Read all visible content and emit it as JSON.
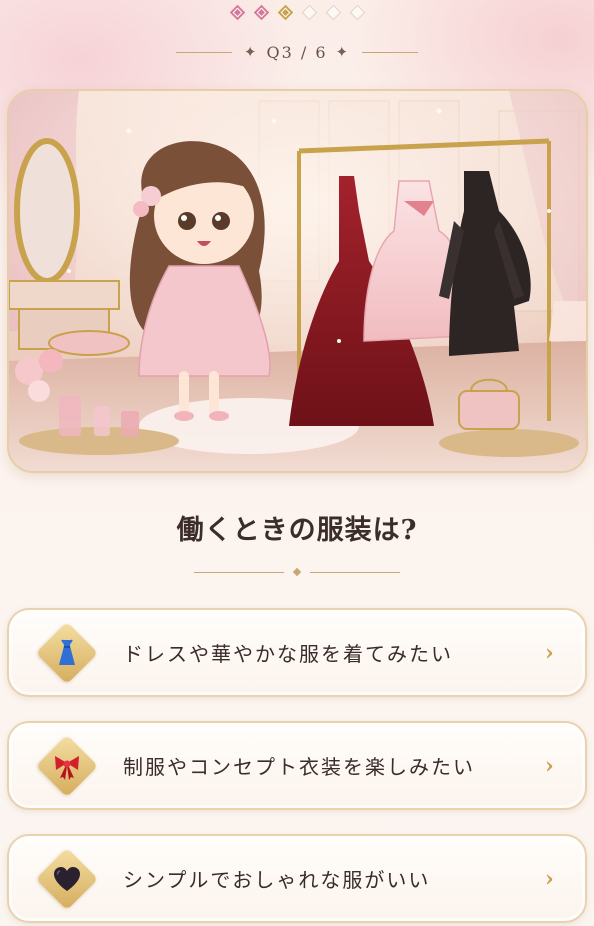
{
  "progress": {
    "counter": "Q3 / 6",
    "steps": [
      "done",
      "done",
      "current",
      "todo",
      "todo",
      "todo"
    ]
  },
  "question": "働くときの服装は?",
  "options": [
    {
      "label": "ドレスや華やかな服を着てみたい",
      "icon": "blue-dress-icon",
      "chevron": "›"
    },
    {
      "label": "制服やコンセプト衣装を楽しみたい",
      "icon": "red-ribbon-icon",
      "chevron": "›"
    },
    {
      "label": "シンプルでおしゃれな服がいい",
      "icon": "black-heart-icon",
      "chevron": "›"
    }
  ],
  "colors": {
    "accent_pink": "#d9779a",
    "accent_gold": "#c9a24e",
    "text": "#3a2c28"
  }
}
